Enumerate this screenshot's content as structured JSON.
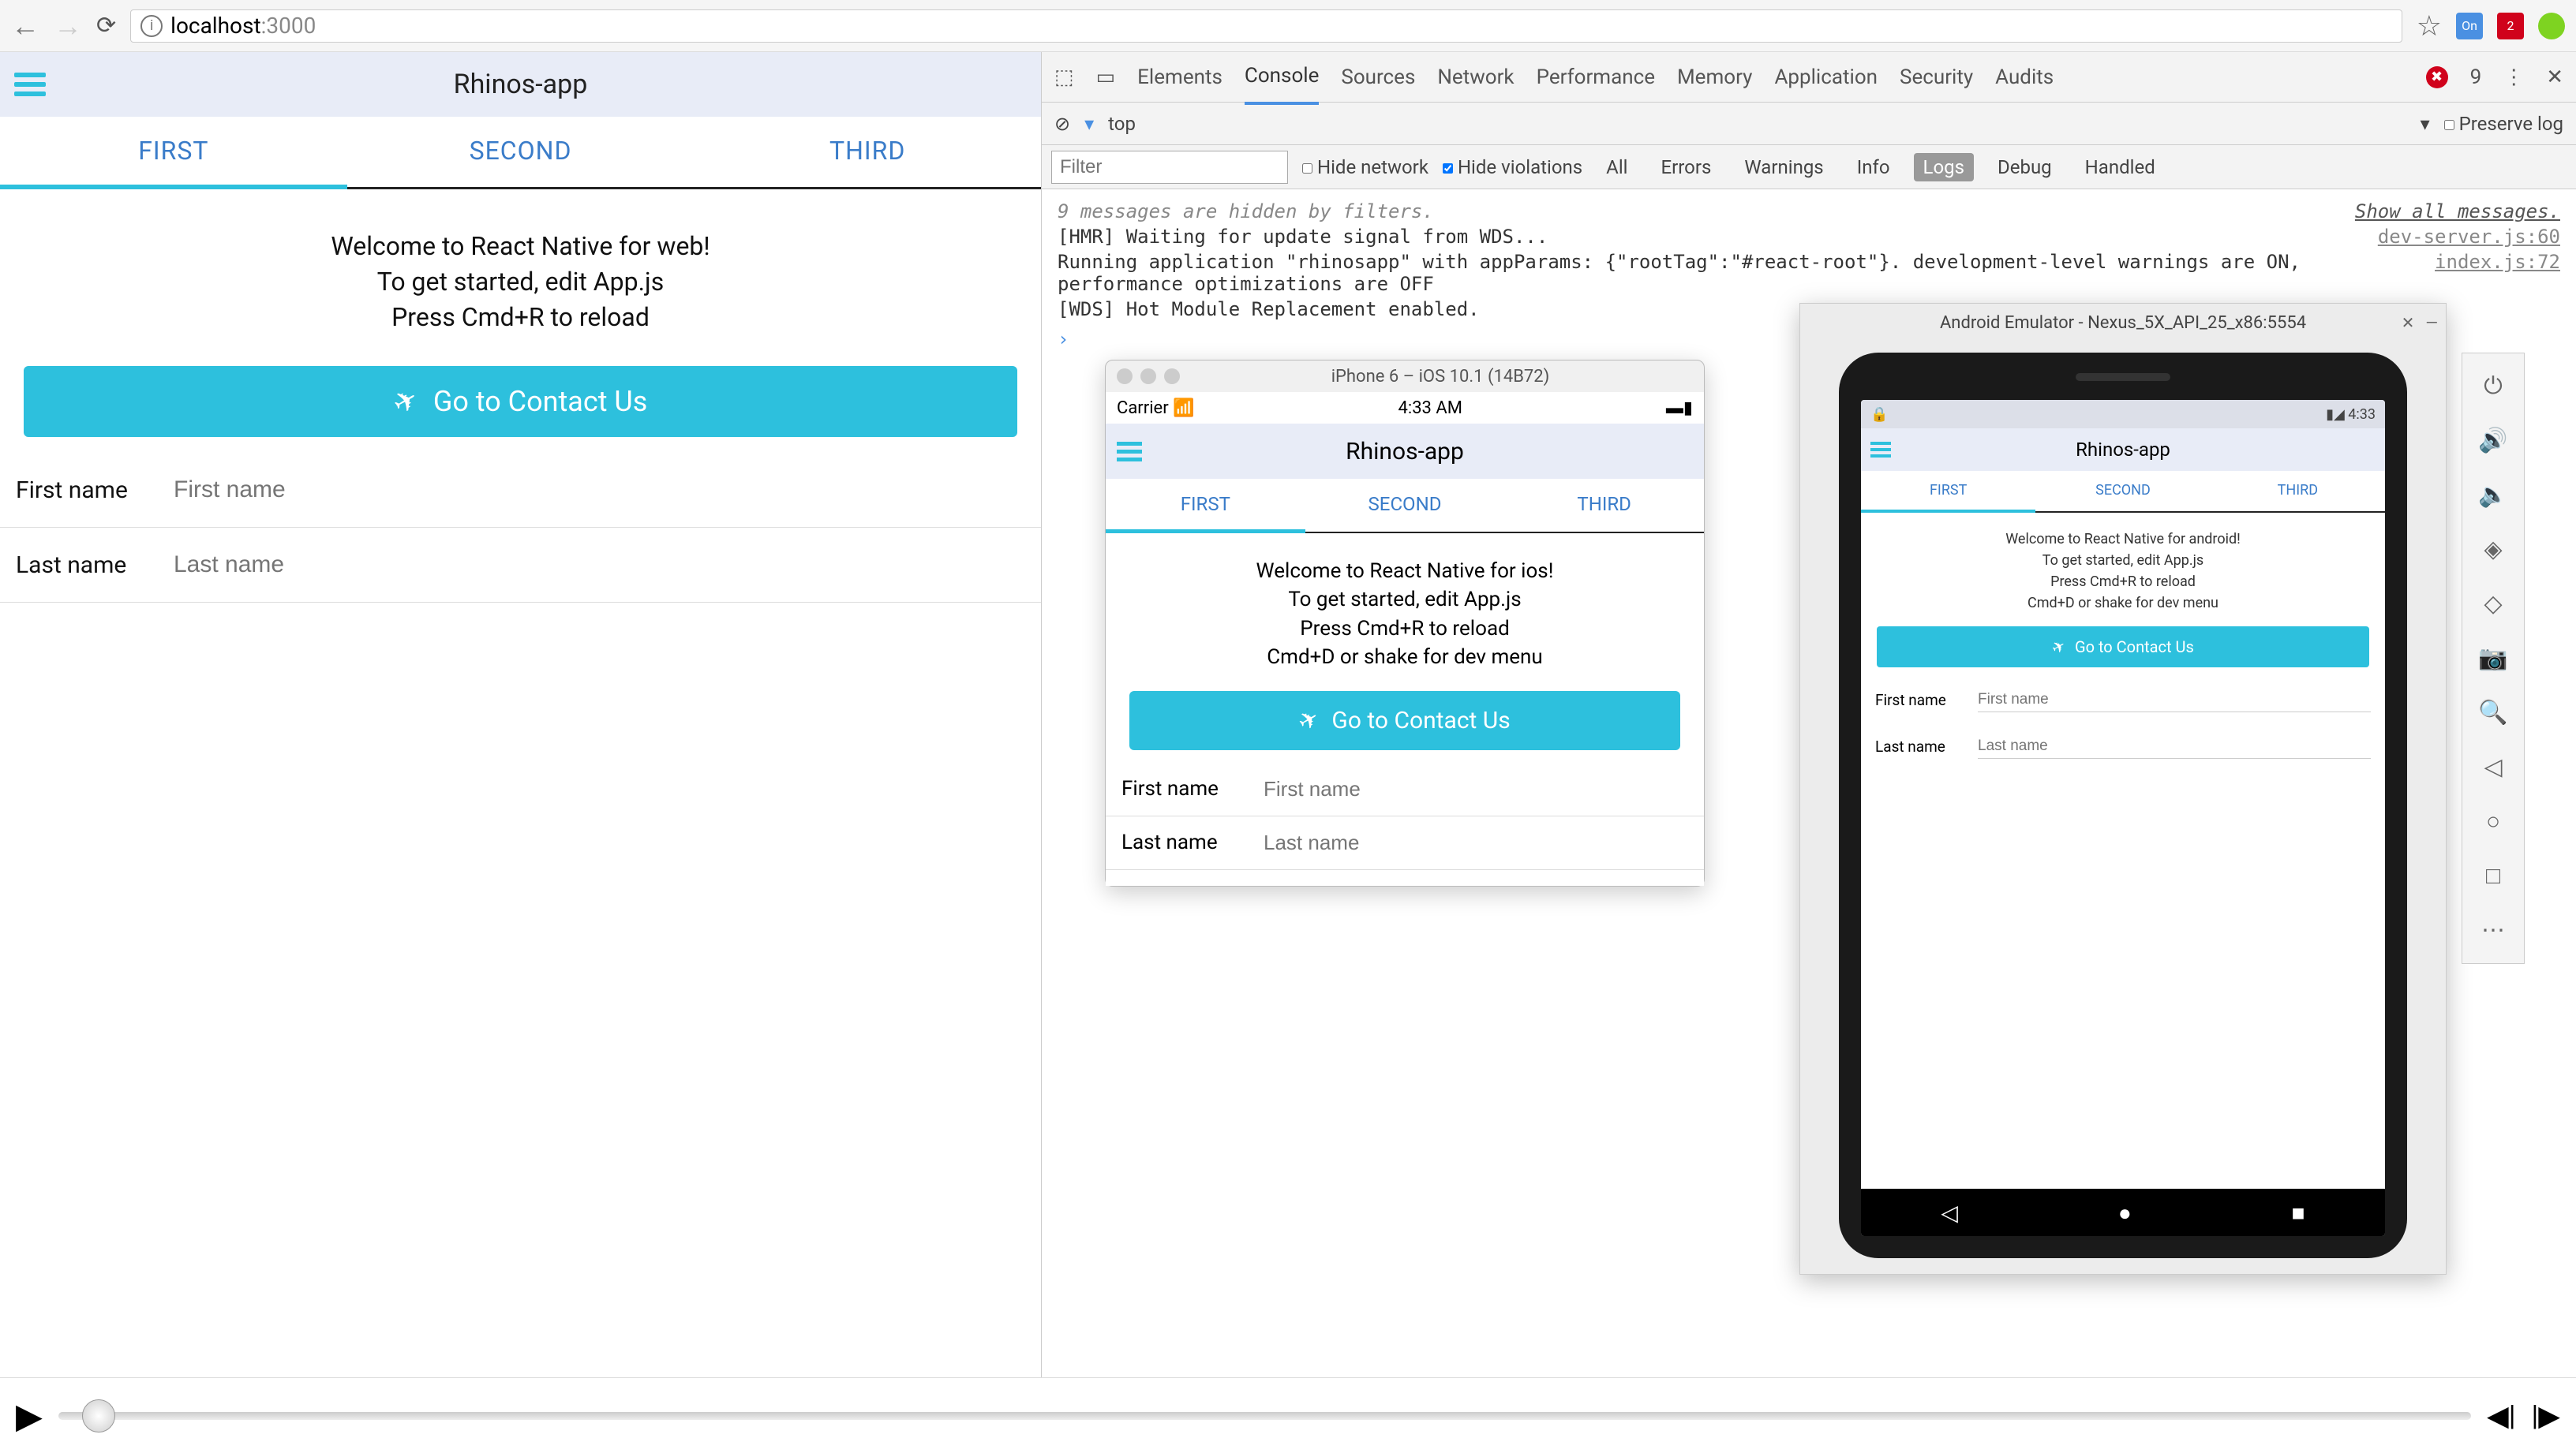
{
  "browser": {
    "url_host": "localhost",
    "url_port": ":3000",
    "ext_badge_1": "On",
    "ext_badge_2": "2"
  },
  "web_app": {
    "title": "Rhinos-app",
    "tabs": [
      "FIRST",
      "SECOND",
      "THIRD"
    ],
    "welcome_l1": "Welcome to React Native for web!",
    "welcome_l2": "To get started, edit App.js",
    "welcome_l3": "Press Cmd+R to reload",
    "cta": "Go to Contact Us",
    "first_name_label": "First name",
    "first_name_placeholder": "First name",
    "last_name_label": "Last name",
    "last_name_placeholder": "Last name"
  },
  "devtools": {
    "tabs": [
      "Elements",
      "Console",
      "Sources",
      "Network",
      "Performance",
      "Memory",
      "Application",
      "Security",
      "Audits"
    ],
    "active_tab": "Console",
    "error_count": "9",
    "context": "top",
    "preserve_log": "Preserve log",
    "filter_placeholder": "Filter",
    "hide_network": "Hide network",
    "hide_violations": "Hide violations",
    "levels": [
      "All",
      "Errors",
      "Warnings",
      "Info",
      "Logs",
      "Debug",
      "Handled"
    ],
    "hidden_msg": "9 messages are hidden by filters.",
    "show_all": "Show all messages.",
    "log1": "[HMR] Waiting for update signal from WDS...",
    "log1_src": "dev-server.js:60",
    "log2": "Running application \"rhinosapp\" with appParams: {\"rootTag\":\"#react-root\"}. development-level warnings are ON, performance optimizations are OFF",
    "log2_src": "index.js:72",
    "log3": "[WDS] Hot Module Replacement enabled."
  },
  "ios": {
    "window_title": "iPhone 6 – iOS 10.1 (14B72)",
    "carrier": "Carrier",
    "time": "4:33 AM",
    "app_title": "Rhinos-app",
    "tabs": [
      "FIRST",
      "SECOND",
      "THIRD"
    ],
    "welcome_l1": "Welcome to React Native for ios!",
    "welcome_l2": "To get started, edit App.js",
    "welcome_l3": "Press Cmd+R to reload",
    "welcome_l4": "Cmd+D or shake for dev menu",
    "cta": "Go to Contact Us",
    "first_name_label": "First name",
    "first_name_placeholder": "First name",
    "last_name_label": "Last name",
    "last_name_placeholder": "Last name"
  },
  "android": {
    "window_title": "Android Emulator - Nexus_5X_API_25_x86:5554",
    "time": "4:33",
    "app_title": "Rhinos-app",
    "tabs": [
      "FIRST",
      "SECOND",
      "THIRD"
    ],
    "welcome_l1": "Welcome to React Native for android!",
    "welcome_l2": "To get started, edit App.js",
    "welcome_l3": "Press Cmd+R to reload",
    "welcome_l4": "Cmd+D or shake for dev menu",
    "cta": "Go to Contact Us",
    "first_name_label": "First name",
    "first_name_placeholder": "First name",
    "last_name_label": "Last name",
    "last_name_placeholder": "Last name"
  }
}
